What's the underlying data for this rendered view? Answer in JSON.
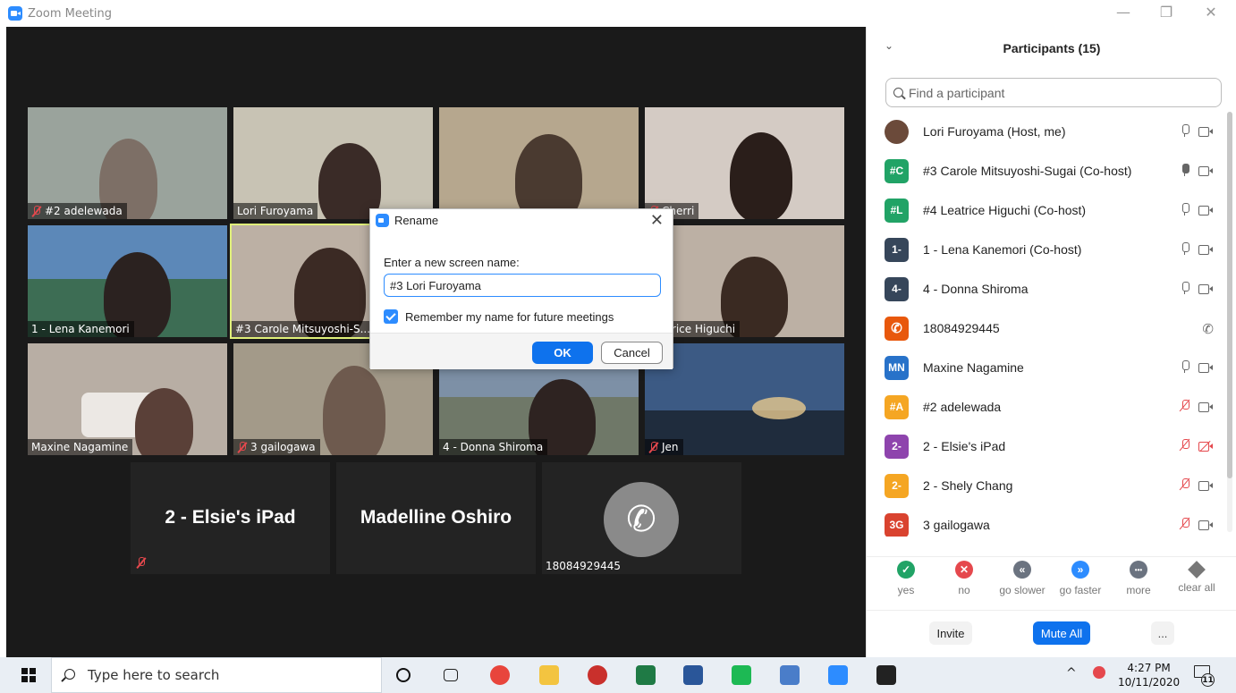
{
  "window": {
    "title": "Zoom Meeting",
    "minimize": "—",
    "restore": "❐",
    "close": "✕"
  },
  "tiles": [
    {
      "name": "#2 adelewada",
      "muted": true,
      "bg": "#9aa39c"
    },
    {
      "name": "Lori Furoyama",
      "muted": false,
      "bg": "#c8c3b4"
    },
    {
      "name": "#3 Carole Mitsuyoshi-S...",
      "muted": false,
      "bg": "#b6a78e"
    },
    {
      "name": "Lena Kanemori",
      "prefix": "1 - ",
      "muted": false,
      "bg": "#5c88b8"
    },
    {
      "name": "Cherri",
      "muted": true,
      "bg": "#d4cbc4"
    },
    {
      "name": "Leatrice Higuchi",
      "muted": false,
      "bg": "#bcb0a4"
    },
    {
      "name": "Maxine Nagamine",
      "muted": false,
      "bg": "#b8aea4"
    },
    {
      "name": "3 gailogawa",
      "muted": true,
      "bg": "#a39a89"
    },
    {
      "name": "4 - Donna Shiroma",
      "muted": false,
      "bg": "#7d90a6"
    },
    {
      "name": "Jen",
      "muted": true,
      "bg": "#3c5a84"
    },
    {
      "name": "2 - Elsie's iPad",
      "muted": true
    },
    {
      "name": "Madelline Oshiro"
    },
    {
      "name": "18084929445"
    }
  ],
  "dialog": {
    "title": "Rename",
    "close": "✕",
    "prompt": "Enter a new screen name:",
    "value": "#3 Lori Furoyama",
    "remember": "Remember my name for future meetings",
    "ok": "OK",
    "cancel": "Cancel"
  },
  "panel": {
    "chevron": "⌄",
    "title": "Participants (15)",
    "search_placeholder": "Find a participant",
    "participants": [
      {
        "initials": "",
        "name": "Lori Furoyama (Host, me)",
        "color": "#6b4a3a",
        "mic": "off",
        "cam": "on"
      },
      {
        "initials": "#C",
        "name": "#3 Carole Mitsuyoshi-Sugai (Co-host)",
        "color": "#21a366",
        "mic": "on",
        "cam": "on"
      },
      {
        "initials": "#L",
        "name": "#4 Leatrice Higuchi (Co-host)",
        "color": "#21a366",
        "mic": "off",
        "cam": "on"
      },
      {
        "initials": "1-",
        "name": "1 - Lena Kanemori (Co-host)",
        "color": "#36465a",
        "mic": "off",
        "cam": "on"
      },
      {
        "initials": "4-",
        "name": "4 - Donna Shiroma",
        "color": "#36465a",
        "mic": "off",
        "cam": "on"
      },
      {
        "initials": "",
        "name": "18084929445",
        "color": "#e8580c",
        "mic": "phone",
        "cam": "none"
      },
      {
        "initials": "MN",
        "name": "Maxine Nagamine",
        "color": "#2872c9",
        "mic": "off",
        "cam": "on"
      },
      {
        "initials": "#A",
        "name": "#2 adelewada",
        "color": "#f5a623",
        "mic": "muted",
        "cam": "on"
      },
      {
        "initials": "2-",
        "name": "2 - Elsie's iPad",
        "color": "#8e44ad",
        "mic": "muted",
        "cam": "off"
      },
      {
        "initials": "2-",
        "name": "2 - Shely Chang",
        "color": "#f5a623",
        "mic": "muted",
        "cam": "on"
      },
      {
        "initials": "3G",
        "name": "3 gailogawa",
        "color": "#d9432f",
        "mic": "muted",
        "cam": "on"
      }
    ],
    "reactions": [
      {
        "label": "yes",
        "glyph": "✓",
        "color": "#21a366"
      },
      {
        "label": "no",
        "glyph": "✕",
        "color": "#e5484d"
      },
      {
        "label": "go slower",
        "glyph": "«",
        "color": "#6b7380"
      },
      {
        "label": "go faster",
        "glyph": "»",
        "color": "#2d8cff"
      },
      {
        "label": "more",
        "glyph": "•••",
        "color": "#6b7380"
      },
      {
        "label": "clear all",
        "glyph": "",
        "color": "#777777"
      }
    ],
    "invite": "Invite",
    "mute_all": "Mute All",
    "more": "..."
  },
  "taskbar": {
    "search_placeholder": "Type here to search",
    "time": "4:27 PM",
    "date": "10/11/2020",
    "notifications": "11",
    "tray_caret": "^"
  }
}
